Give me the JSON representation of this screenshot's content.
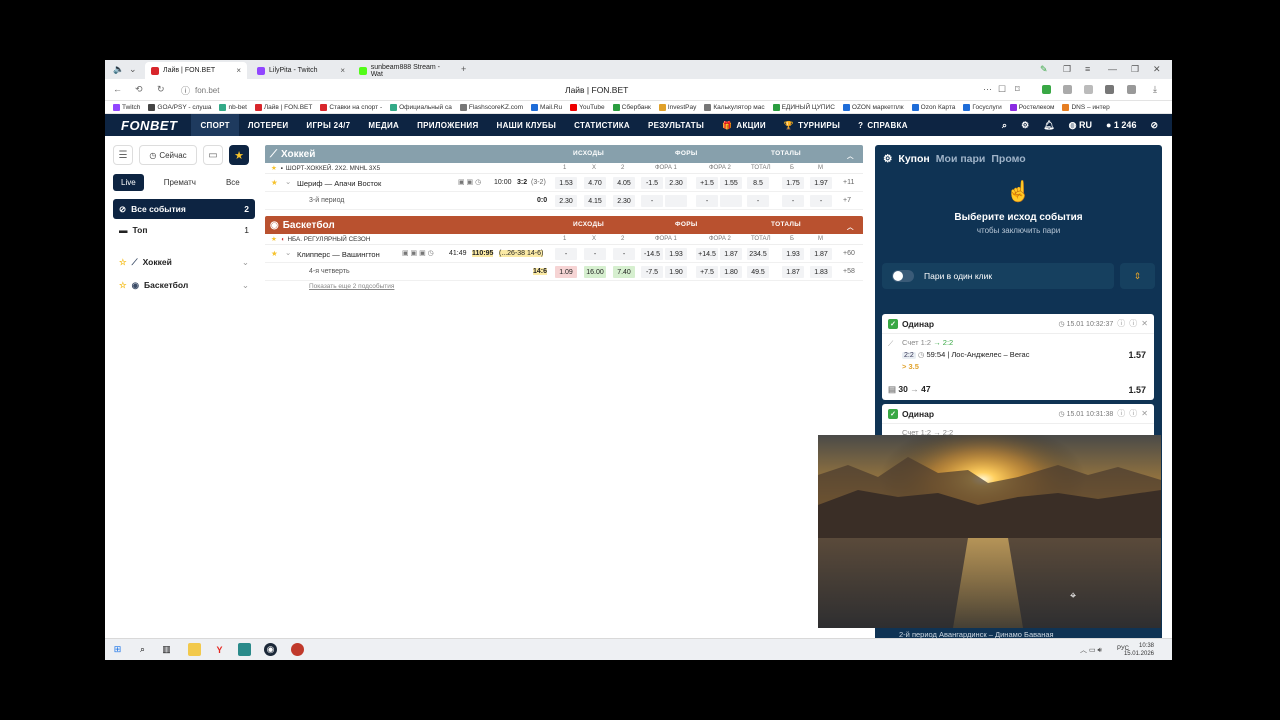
{
  "browser": {
    "tabs": [
      {
        "label": "Лайв | FON.BET",
        "color": "#d8262c",
        "active": true
      },
      {
        "label": "LilyPita - Twitch",
        "color": "#9146ff",
        "active": false
      },
      {
        "label": "sunbeam888 Stream - Wat",
        "color": "#53fc18",
        "active": false
      }
    ],
    "url": "fon.bet",
    "page_title": "Лайв | FON.BET",
    "bookmarks": [
      "Twitch",
      "GOA/PSY - слуша",
      "nb-bet",
      "Лайв | FON.BET",
      "Ставки на спорт -",
      "Официальный са",
      "FlashscoreKZ.com",
      "Mail.Ru",
      "YouTube",
      "Сбербанк",
      "InvestPay",
      "Калькулятор мас",
      "ЕДИНЫЙ ЦУПИС",
      "OZON маркетплк",
      "Ozon Карта",
      "Госуслуги",
      "Ростелеком",
      "DNS – интер"
    ]
  },
  "site": {
    "logo": "FONBET",
    "nav": [
      "СПОРТ",
      "ЛОТЕРЕИ",
      "ИГРЫ 24/7",
      "МЕДИА",
      "ПРИЛОЖЕНИЯ",
      "НАШИ КЛУБЫ",
      "СТАТИСТИКА",
      "РЕЗУЛЬТАТЫ"
    ],
    "promo_nav": [
      "АКЦИИ",
      "ТУРНИРЫ",
      "СПРАВКА"
    ],
    "lang": "RU",
    "balance": "1 246"
  },
  "sidebar": {
    "now_label": "Сейчас",
    "modes": [
      "Live",
      "Прематч",
      "Все"
    ],
    "all_events": {
      "label": "Все события",
      "count": "2"
    },
    "top": {
      "label": "Топ",
      "count": "1"
    },
    "sports": [
      {
        "label": "Хоккей"
      },
      {
        "label": "Баскетбол"
      }
    ]
  },
  "columns": {
    "outcomes": "ИСХОДЫ",
    "handicaps": "ФОРЫ",
    "totals": "ТОТАЛЫ",
    "sub": [
      "1",
      "X",
      "2",
      "ФОРА 1",
      "ФОРА 2",
      "ТОТАЛ",
      "Б",
      "М"
    ]
  },
  "hockey": {
    "title": "Хоккей",
    "league": "ШОРТ-ХОККЕЙ. 2Х2. MNHL 3X5",
    "event": {
      "name": "Шериф — Апачи Восток",
      "time": "10:00",
      "score": "3:2",
      "sub": "(3-2)",
      "odds": [
        "1.53",
        "4.70",
        "4.05",
        "-1.5",
        "2.30",
        "+1.5",
        "1.55",
        "8.5",
        "1.75",
        "1.97"
      ],
      "more": "+11"
    },
    "period": {
      "name": "3-й период",
      "score": "0:0",
      "odds": [
        "2.30",
        "4.15",
        "2.30",
        "-",
        "",
        "-",
        "",
        "-",
        "-",
        "-"
      ],
      "more": "+7"
    }
  },
  "basketball": {
    "title": "Баскетбол",
    "league": "НБА. РЕГУЛЯРНЫЙ СЕЗОН",
    "event": {
      "name": "Клипперс — Вашингтон",
      "time": "41:49",
      "score": "110:95",
      "sub": "(...26-38 14-6)",
      "odds": [
        "-",
        "-",
        "-",
        "-14.5",
        "1.93",
        "+14.5",
        "1.87",
        "234.5",
        "1.93",
        "1.87"
      ],
      "more": "+60"
    },
    "period": {
      "name": "4-я четверть",
      "score": "14:6",
      "odds": [
        "1.09",
        "16.00",
        "7.40",
        "-7.5",
        "1.90",
        "+7.5",
        "1.80",
        "49.5",
        "1.87",
        "1.83"
      ],
      "more": "+58"
    },
    "show_more": "Показать еще 2 подсобытия"
  },
  "coupon": {
    "tabs": [
      "Купон",
      "Мои пари",
      "Промо"
    ],
    "empty_title": "Выберите исход события",
    "empty_sub": "чтобы заключить пари",
    "one_click": "Пари в один клик",
    "bets": [
      {
        "type": "Одинар",
        "date": "15.01",
        "time": "10:32:37",
        "market": "Счет 1:2",
        "arrow": "→",
        "new": "2:2",
        "score": "2:2",
        "clock": "59:54",
        "event": "Лос-Анджелес – Вегас",
        "outcome": "> 3.5",
        "odd": "1.57",
        "stake": "30",
        "payout": "47",
        "total": "1.57"
      },
      {
        "type": "Одинар",
        "date": "15.01",
        "time": "10:31:38",
        "market": "Счет 1:2 → 2:2"
      }
    ],
    "partial_bottom": "2-й период Авангардинск – Динамо Баваная"
  },
  "taskbar": {
    "lang": "РУС",
    "time": "10:38",
    "date": "15.01.2026"
  }
}
